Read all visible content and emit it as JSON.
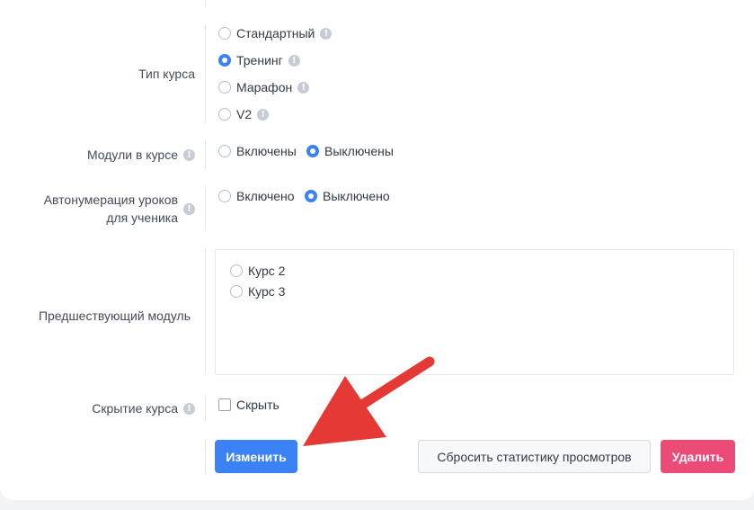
{
  "course_type": {
    "label": "Тип курса",
    "options": [
      {
        "label": "Стандартный",
        "selected": false
      },
      {
        "label": "Тренинг",
        "selected": true
      },
      {
        "label": "Марафон",
        "selected": false
      },
      {
        "label": "V2",
        "selected": false
      }
    ]
  },
  "modules": {
    "label": "Модули в курсе",
    "on": "Включены",
    "off": "Выключены",
    "selected": "off"
  },
  "autonumbering": {
    "label_line1": "Автонумерация уроков",
    "label_line2": "для ученика",
    "on": "Включено",
    "off": "Выключено",
    "selected": "off"
  },
  "previous_module": {
    "label": "Предшествующий модуль",
    "options": [
      "Курс 2",
      "Курс 3"
    ]
  },
  "hide_course": {
    "label": "Скрытие курса",
    "checkbox_label": "Скрыть",
    "checked": false
  },
  "info_glyph": "!",
  "buttons": {
    "save": "Изменить",
    "reset_stats": "Сбросить статистику просмотров",
    "delete": "Удалить"
  },
  "colors": {
    "primary": "#3b82f6",
    "danger": "#ec4b78",
    "annotation_arrow": "#e53935"
  }
}
